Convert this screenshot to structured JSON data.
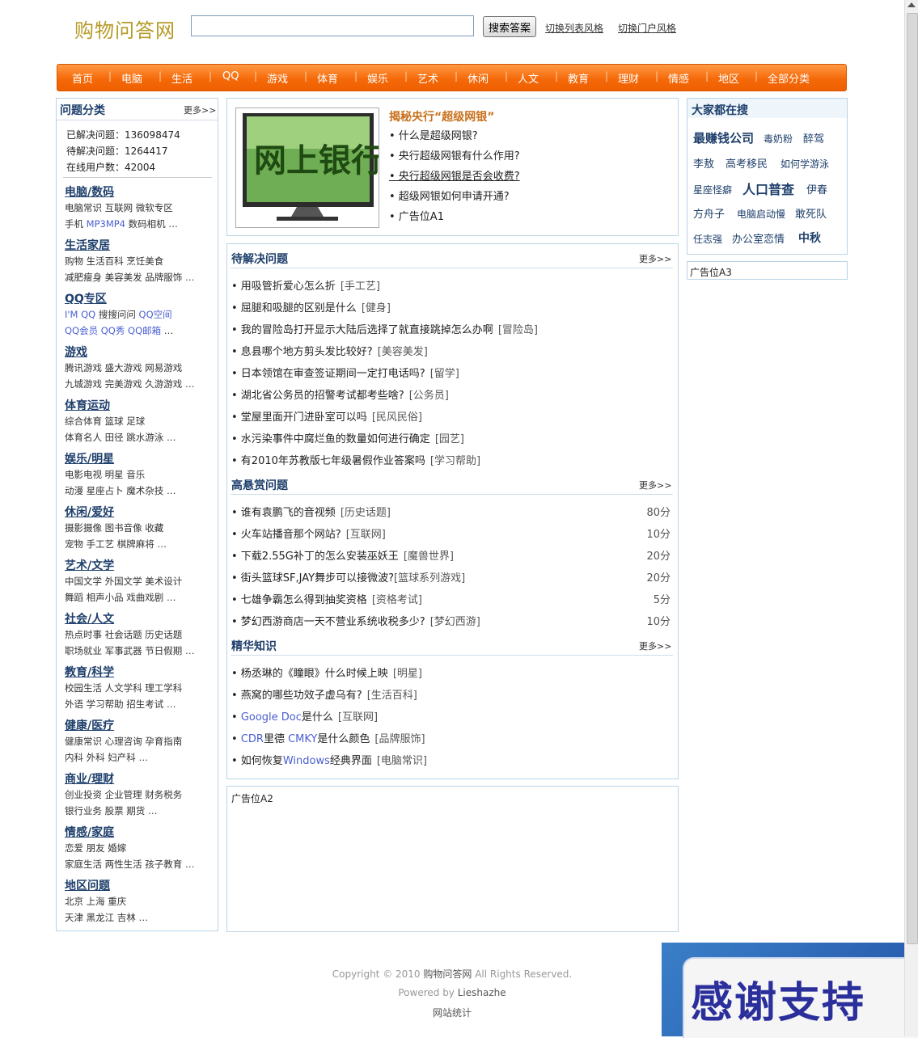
{
  "header": {
    "logo": "购物问答网",
    "search_placeholder": "",
    "search_button": "搜索答案",
    "link_list_style": "切换列表风格",
    "link_portal_style": "切换门户风格"
  },
  "nav": [
    "首页",
    "电脑",
    "生活",
    "QQ",
    "游戏",
    "体育",
    "娱乐",
    "艺术",
    "休闲",
    "人文",
    "教育",
    "理财",
    "情感",
    "地区",
    "全部分类"
  ],
  "left": {
    "title": "问题分类",
    "more": "更多>>",
    "stats": [
      {
        "label": "已解决问题：",
        "value": "136098474"
      },
      {
        "label": "待解决问题：",
        "value": "1264417"
      },
      {
        "label": "在线用户数：",
        "value": "42004"
      }
    ],
    "categories": [
      {
        "title": "电脑/数码",
        "line1": "电脑常识 互联网 微软专区",
        "line2a": "手机 ",
        "line2b": "MP3MP4",
        "line2c": " 数码相机 …"
      },
      {
        "title": "生活家居",
        "line1": "购物 生活百科 烹饪美食",
        "line2a": "减肥瘦身 美容美发 品牌服饰 …",
        "line2b": "",
        "line2c": ""
      },
      {
        "title": "QQ专区",
        "line1b": "I'M QQ",
        "line1": " 搜搜问问 ",
        "line1c": "QQ空间",
        "line2b": "QQ会员 QQ秀 QQ邮箱",
        "line2c": " …"
      },
      {
        "title": "游戏",
        "line1": "腾讯游戏 盛大游戏 网易游戏",
        "line2a": "九城游戏 完美游戏 久游游戏 …",
        "line2b": "",
        "line2c": ""
      },
      {
        "title": "体育运动",
        "line1": "综合体育 篮球 足球",
        "line2a": "体育名人 田径 跳水游泳 …",
        "line2b": "",
        "line2c": ""
      },
      {
        "title": "娱乐/明星",
        "line1": "电影电视 明星 音乐",
        "line2a": "动漫 星座占卜 魔术杂技 …",
        "line2b": "",
        "line2c": ""
      },
      {
        "title": "休闲/爱好",
        "line1": "摄影摄像 图书音像 收藏",
        "line2a": "宠物 手工艺 棋牌麻将 …",
        "line2b": "",
        "line2c": ""
      },
      {
        "title": "艺术/文学",
        "line1": "中国文学 外国文学 美术设计",
        "line2a": "舞蹈 相声小品 戏曲戏剧 …",
        "line2b": "",
        "line2c": ""
      },
      {
        "title": "社会/人文",
        "line1": "热点时事 社会话题 历史话题",
        "line2a": "职场就业 军事武器 节日假期 …",
        "line2b": "",
        "line2c": ""
      },
      {
        "title": "教育/科学",
        "line1": "校园生活 人文学科 理工学科",
        "line2a": "外语 学习帮助 招生考试 …",
        "line2b": "",
        "line2c": ""
      },
      {
        "title": "健康/医疗",
        "line1": "健康常识 心理咨询 孕育指南",
        "line2a": "内科 外科 妇产科 …",
        "line2b": "",
        "line2c": ""
      },
      {
        "title": "商业/理财",
        "line1": "创业投资 企业管理 财务税务",
        "line2a": "银行业务 股票 期货 …",
        "line2b": "",
        "line2c": ""
      },
      {
        "title": "情感/家庭",
        "line1": "恋爱 朋友 婚嫁",
        "line2a": "家庭生活 两性生活 孩子教育 …",
        "line2b": "",
        "line2c": ""
      },
      {
        "title": "地区问题",
        "line1": "北京 上海 重庆",
        "line2a": "天津 黑龙江 吉林 …",
        "line2b": "",
        "line2c": ""
      }
    ]
  },
  "feature": {
    "image_alt": "网上银行",
    "title": "揭秘央行“超级网银”",
    "items": [
      "• 什么是超级网银?",
      "• 央行超级网银有什么作用?",
      "• 央行超级网银是否会收费?",
      "• 超级网银如何申请开通?",
      "• 广告位A1"
    ]
  },
  "pending": {
    "title": "待解决问题",
    "more": "更多>>",
    "items": [
      {
        "q": "• 用吸管折爱心怎么折",
        "tag": "[手工艺]"
      },
      {
        "q": "• 屈腿和吸腿的区别是什么",
        "tag": "[健身]"
      },
      {
        "q": "• 我的冒险岛打开显示大陆后选择了就直接跳掉怎么办啊",
        "tag": "[冒险岛]"
      },
      {
        "q": "• 息县哪个地方剪头发比较好?",
        "tag": "[美容美发]"
      },
      {
        "q": "• 日本领馆在审查签证期间一定打电话吗?",
        "tag": "[留学]"
      },
      {
        "q": "• 湖北省公务员的招警考试都考些啥?",
        "tag": "[公务员]"
      },
      {
        "q": "• 堂屋里面开门进卧室可以吗",
        "tag": "[民风民俗]"
      },
      {
        "q": "• 水污染事件中腐烂鱼的数量如何进行确定",
        "tag": "[园艺]"
      },
      {
        "q": "• 有2010年苏教版七年级暑假作业答案吗",
        "tag": "[学习帮助]"
      }
    ]
  },
  "reward": {
    "title": "高悬赏问题",
    "more": "更多>>",
    "items": [
      {
        "q": "• 谁有袁鹏飞的音视频",
        "tag": "[历史话题]",
        "score": "80分"
      },
      {
        "q": "• 火车站播音那个网站?",
        "tag": "[互联网]",
        "score": "10分"
      },
      {
        "q": "• 下载2.55G补丁的怎么安装巫妖王",
        "tag": "[魔兽世界]",
        "score": "20分"
      },
      {
        "q": "• 街头篮球SF,JAY舞步可以接微波?",
        "tag": "[篮球系列游戏]",
        "score": "20分"
      },
      {
        "q": "• 七雄争霸怎么得到抽奖资格",
        "tag": "[资格考试]",
        "score": "5分"
      },
      {
        "q": "• 梦幻西游商店一天不营业系统收税多少?",
        "tag": "[梦幻西游]",
        "score": "10分"
      }
    ]
  },
  "essence": {
    "title": "精华知识",
    "more": "更多>>",
    "items": [
      {
        "pre": "• 杨丞琳的《瞳眼》什么时候上映",
        "blue": "",
        "post": "",
        "tag": "[明星]"
      },
      {
        "pre": "• 燕窝的哪些功效子虚乌有?",
        "blue": "",
        "post": "",
        "tag": "[生活百科]"
      },
      {
        "pre": "• ",
        "blue": "Google Doc",
        "post": "是什么",
        "tag": "[互联网]"
      },
      {
        "pre": "• ",
        "blue": "CDR",
        "post": "里德  ",
        "blue2": "CMKY",
        "post2": "是什么颜色",
        "tag": "[品牌服饰]"
      },
      {
        "pre": "• 如何恢复",
        "blue": "Windows",
        "post": "经典界面",
        "tag": "[电脑常识]"
      }
    ]
  },
  "ads": {
    "a2": "广告位A2",
    "a3": "广告位A3"
  },
  "hot": {
    "title": "大家都在搜",
    "words": [
      "最赚钱公司",
      "毒奶粉",
      "醉驾",
      "李敖",
      "高考移民",
      "如何学游泳",
      "星座怪癖",
      "人口普查",
      "伊春",
      "方舟子",
      "电脑启动慢",
      "敢死队",
      "任志强",
      "办公室恋情",
      "中秋"
    ]
  },
  "footer": {
    "copyright_pre": "Copyright © 2010 ",
    "copyright_site": "购物问答网",
    "copyright_post": " All Rights Reserved.",
    "powered_pre": "Powered by ",
    "powered_name": "Lieshazhe",
    "stats_link": "网站统计"
  },
  "badge": "感谢支持"
}
